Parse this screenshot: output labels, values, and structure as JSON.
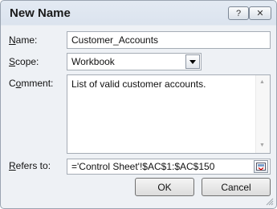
{
  "window": {
    "title": "New Name",
    "help_label": "?",
    "close_label": "✕"
  },
  "labels": {
    "name_pre": "",
    "name_key": "N",
    "name_post": "ame:",
    "scope_pre": "",
    "scope_key": "S",
    "scope_post": "cope:",
    "comment_pre": "C",
    "comment_key": "o",
    "comment_post": "mment:",
    "refers_pre": "",
    "refers_key": "R",
    "refers_post": "efers to:"
  },
  "fields": {
    "name": "Customer_Accounts",
    "scope": "Workbook",
    "comment": "List of valid customer accounts.",
    "refers_to": "='Control Sheet'!$AC$1:$AC$150"
  },
  "buttons": {
    "ok": "OK",
    "cancel": "Cancel"
  },
  "icons": {
    "help": "help-icon",
    "close": "close-icon",
    "dropdown": "chevron-down-icon",
    "range": "collapse-dialog-icon",
    "grip": "resize-grip-icon"
  }
}
